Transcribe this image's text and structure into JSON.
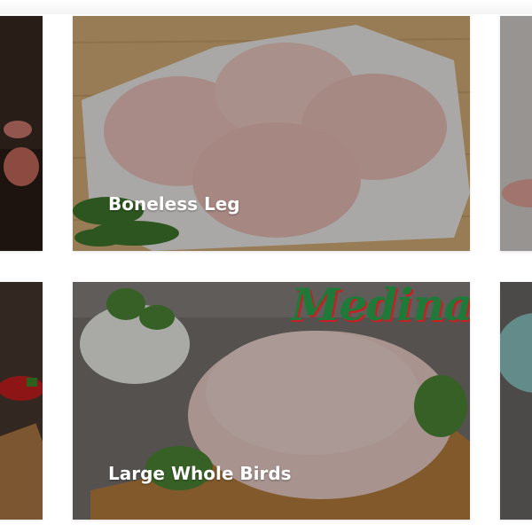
{
  "products": [
    {
      "label": "Boneless Leg"
    },
    {
      "label": "Large Whole Birds"
    }
  ],
  "brand": {
    "logo_text": "Medina",
    "color": "#1f7a3a",
    "outline": "#c81e24"
  }
}
